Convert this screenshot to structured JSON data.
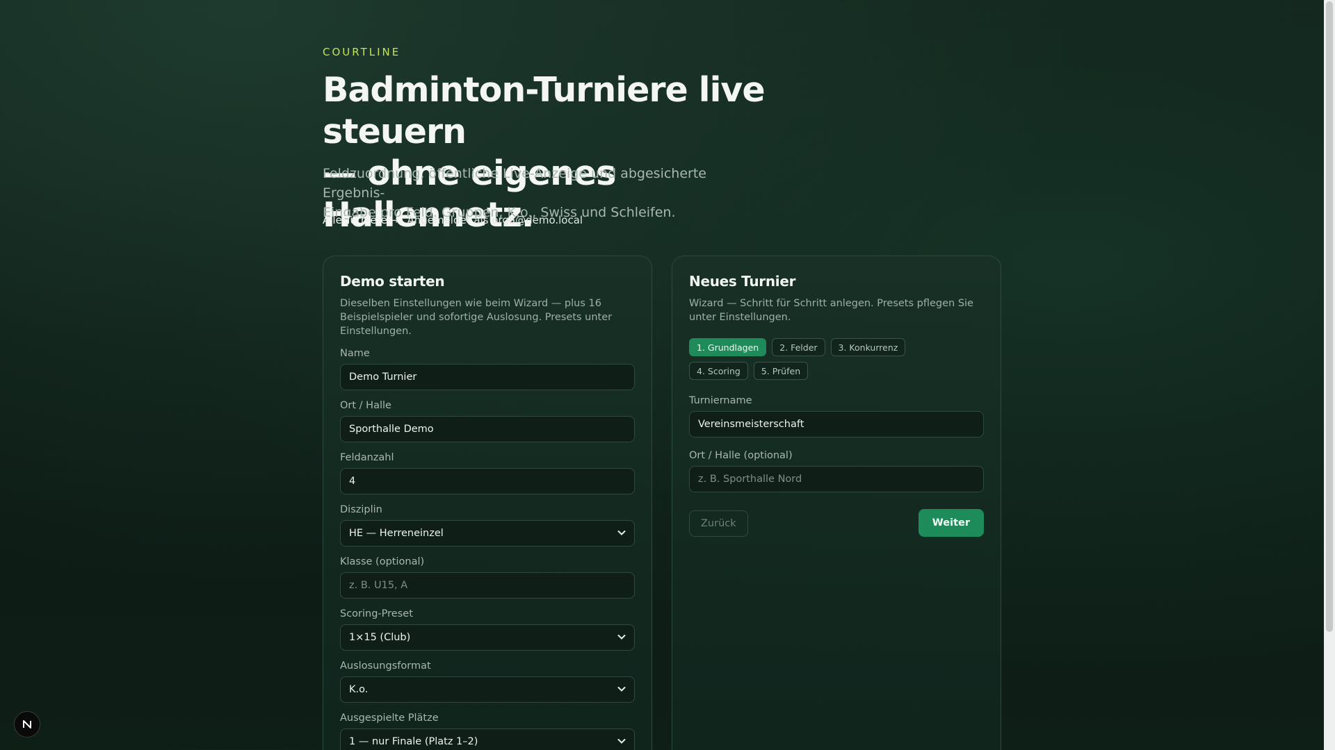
{
  "brand": "COURTLINE",
  "hero": {
    "title_line1": "Badminton-Turniere live steuern",
    "title_line2": "— ohne eigenes Hallennetz.",
    "sub_line1": "Feldzuordnung, öffentliche Live-Anzeige und abgesicherte Ergebnis-",
    "sub_line2": "Eingabe pro Feld. Gruppen, K.o., Swiss und Schleifen."
  },
  "links": {
    "all_tournaments": "Alle Turniere",
    "arrow": "→",
    "logged_in": "Angemeldet als orga@demo.local"
  },
  "demo": {
    "title": "Demo starten",
    "desc": "Dieselben Einstellungen wie beim Wizard — plus 16 Beispielspieler und sofortige Auslosung. Presets unter Einstellungen.",
    "fields": {
      "name_label": "Name",
      "name_value": "Demo Turnier",
      "venue_label": "Ort / Halle",
      "venue_value": "Sporthalle Demo",
      "courts_label": "Feldanzahl",
      "courts_value": "4",
      "discipline_label": "Disziplin",
      "discipline_value": "HE — Herreneinzel",
      "class_label": "Klasse (optional)",
      "class_placeholder": "z. B. U15, A",
      "scoring_label": "Scoring-Preset",
      "scoring_value": "1×15 (Club)",
      "draw_label": "Auslosungsformat",
      "draw_value": "K.o.",
      "places_label": "Ausgespielte Plätze",
      "places_value": "1 — nur Finale (Platz 1–2)"
    }
  },
  "wizard": {
    "title": "Neues Turnier",
    "desc": "Wizard — Schritt für Schritt anlegen. Presets pflegen Sie unter Einstellungen.",
    "steps": [
      "1. Grundlagen",
      "2. Felder",
      "3. Konkurrenz",
      "4. Scoring",
      "5. Prüfen"
    ],
    "active_step": 0,
    "name_label": "Turniername",
    "name_value": "Vereinsmeisterschaft",
    "venue_label": "Ort / Halle (optional)",
    "venue_placeholder": "z. B. Sporthalle Nord",
    "back_label": "Zurück",
    "next_label": "Weiter"
  },
  "colors": {
    "accent": "#1e8b5a",
    "brand": "#c3e45a",
    "background": "#0c1a14"
  },
  "icons": {
    "select": "chevron-down-icon",
    "dev_badge": "next-logo-icon"
  }
}
